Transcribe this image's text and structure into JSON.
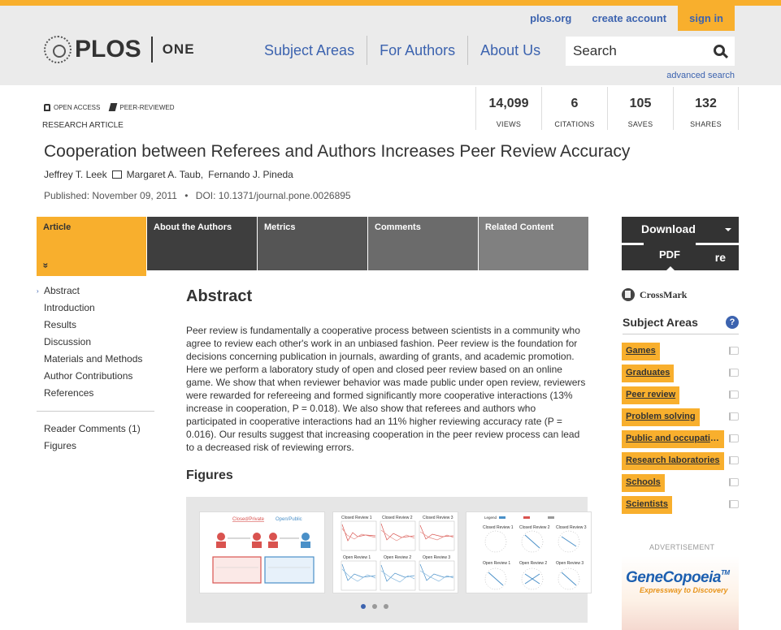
{
  "header": {
    "top_links": [
      "plos.org",
      "create account"
    ],
    "signin_label": "sign in",
    "logo_text": "PLOS",
    "logo_sub": "ONE",
    "nav": [
      "Subject Areas",
      "For Authors",
      "About Us"
    ],
    "search_placeholder": "Search",
    "advanced_search": "advanced search"
  },
  "article": {
    "badges": [
      "OPEN ACCESS",
      "PEER-REVIEWED"
    ],
    "type": "RESEARCH ARTICLE",
    "title": "Cooperation between Referees and Authors Increases Peer Review Accuracy",
    "authors": [
      "Jeffrey T. Leek",
      "Margaret A. Taub,",
      "Fernando J. Pineda"
    ],
    "published": "Published: November 09, 2011",
    "doi": "DOI: 10.1371/journal.pone.0026895",
    "bullet": "•"
  },
  "metrics": [
    {
      "value": "14,099",
      "label": "VIEWS"
    },
    {
      "value": "6",
      "label": "CITATIONS"
    },
    {
      "value": "105",
      "label": "SAVES"
    },
    {
      "value": "132",
      "label": "SHARES"
    }
  ],
  "tabs": [
    "Article",
    "About the Authors",
    "Metrics",
    "Comments",
    "Related Content"
  ],
  "tab_chevron": "»",
  "download": {
    "label": "Download",
    "pdf": "PDF",
    "share": "re"
  },
  "crossmark": "CrossMark",
  "leftnav": {
    "marker": "›",
    "items": [
      "Abstract",
      "Introduction",
      "Results",
      "Discussion",
      "Materials and Methods",
      "Author Contributions",
      "References"
    ],
    "extra": [
      "Reader Comments (1)",
      "Figures"
    ]
  },
  "abstract": {
    "heading": "Abstract",
    "text": "Peer review is fundamentally a cooperative process between scientists in a community who agree to review each other's work in an unbiased fashion. Peer review is the foundation for decisions concerning publication in journals, awarding of grants, and academic promotion. Here we perform a laboratory study of open and closed peer review based on an online game. We show that when reviewer behavior was made public under open review, reviewers were rewarded for refereeing and formed significantly more cooperative interactions (13% increase in cooperation, P = 0.018). We also show that referees and authors who participated in cooperative interactions had an 11% higher reviewing accuracy rate (P = 0.016). Our results suggest that increasing cooperation in the peer review process can lead to a decreased risk of reviewing errors."
  },
  "figures": {
    "heading": "Figures",
    "fig1": {
      "left": "Closed/Private",
      "right": "Open/Public"
    },
    "fig2": {
      "top": [
        "Closed Review 1",
        "Closed Review 2",
        "Closed Review 3"
      ],
      "bottom": [
        "Open Review 1",
        "Open Review 2",
        "Open Review 3"
      ]
    },
    "fig3": {
      "legend": "Legend",
      "top": [
        "Closed Review 1",
        "Closed Review 2",
        "Closed Review 3"
      ],
      "bottom": [
        "Open Review 1",
        "Open Review 2",
        "Open Review 3"
      ]
    },
    "carousel_active": 1
  },
  "subject_areas": {
    "heading": "Subject Areas",
    "help": "?",
    "items": [
      "Games",
      "Graduates",
      "Peer review",
      "Problem solving",
      "Public and occupational health",
      "Research laboratories",
      "Schools",
      "Scientists"
    ]
  },
  "ad": {
    "label": "ADVERTISEMENT",
    "brand": "GeneCopoeia",
    "tm": "TM",
    "slogan": "Expressway to Discovery"
  },
  "colors": {
    "accent": "#f8af2d",
    "link": "#3c63af",
    "closed": "#d9534f",
    "open": "#4a90c8"
  }
}
